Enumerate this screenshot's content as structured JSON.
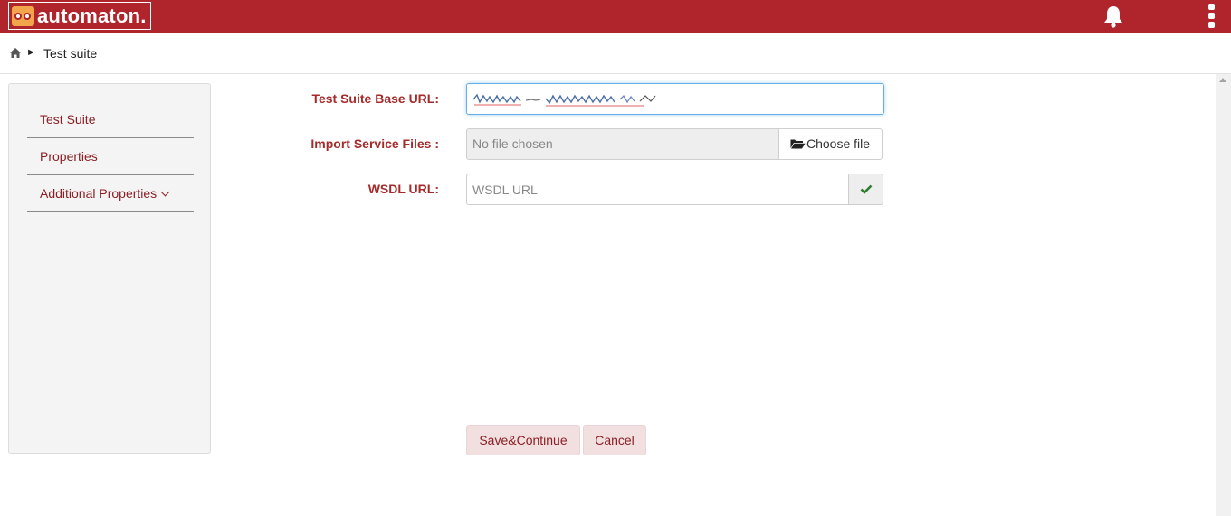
{
  "header": {
    "logo_text": "automaton.",
    "brand_color": "#b0252b",
    "icons": [
      "robot-face-logo-icon",
      "bell-icon",
      "kebab-menu-icon"
    ]
  },
  "breadcrumb": {
    "separator": "►",
    "title": "Test suite"
  },
  "sidebar": {
    "items": [
      {
        "label": "Test Suite"
      },
      {
        "label": "Properties"
      },
      {
        "label": "Additional Properties",
        "expandable": true
      }
    ]
  },
  "form": {
    "base_url": {
      "label": "Test Suite Base URL:",
      "value": ""
    },
    "import": {
      "label": "Import Service Files :",
      "file_status": "No file chosen",
      "choose_label": "Choose file"
    },
    "wsdl": {
      "label": "WSDL URL:",
      "placeholder": "WSDL URL",
      "value": ""
    }
  },
  "actions": {
    "save_label": "Save&Continue",
    "cancel_label": "Cancel"
  }
}
